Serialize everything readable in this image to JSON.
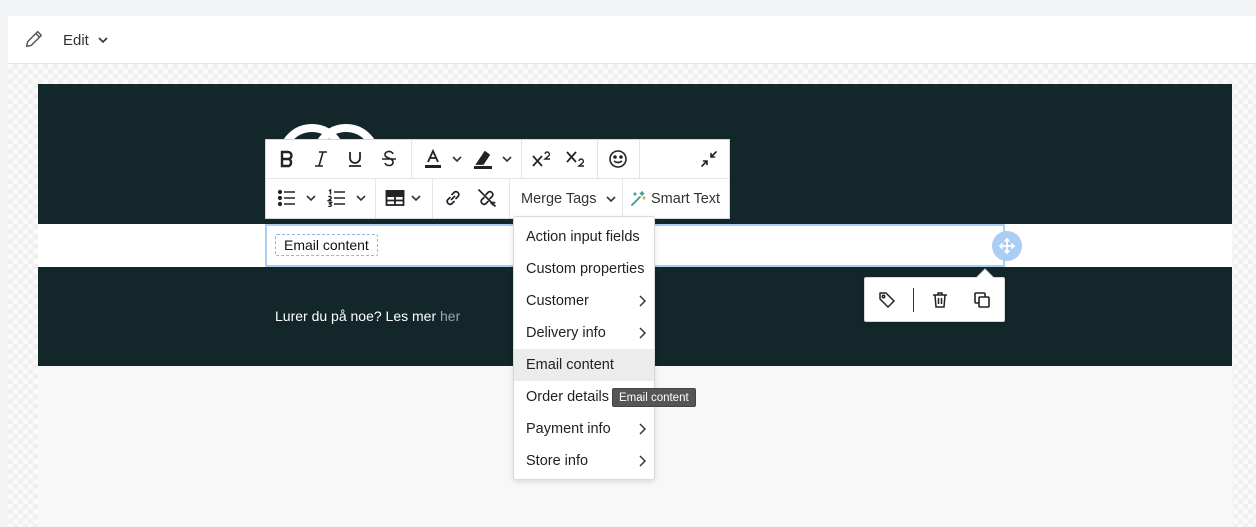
{
  "toolbar": {
    "mode_label": "Edit",
    "pencil_icon": "pencil-icon",
    "chevron_icon": "chevron-down-icon"
  },
  "email": {
    "header_color": "#13262a",
    "merge_chip_label": "Email content",
    "footer_text": "Lurer du på noe? Les mer ",
    "footer_link": "her"
  },
  "rich_text_toolbar": {
    "row1": [
      "bold-icon",
      "italic-icon",
      "underline-icon",
      "strikethrough-icon",
      "font-color-icon",
      "highlight-icon",
      "superscript-icon",
      "subscript-icon",
      "emoji-icon",
      "collapse-icon"
    ],
    "row2": [
      "bulleted-list-icon",
      "numbered-list-icon",
      "table-icon",
      "link-icon",
      "unlink-icon"
    ],
    "merge_tags_label": "Merge Tags",
    "smart_text_label": "Smart Text"
  },
  "merge_tags_menu": {
    "items": [
      {
        "label": "Action input fields",
        "has_submenu": false
      },
      {
        "label": "Custom properties",
        "has_submenu": false
      },
      {
        "label": "Customer",
        "has_submenu": true
      },
      {
        "label": "Delivery info",
        "has_submenu": true
      },
      {
        "label": "Email content",
        "has_submenu": false,
        "hovered": true
      },
      {
        "label": "Order details",
        "has_submenu": false
      },
      {
        "label": "Payment info",
        "has_submenu": true
      },
      {
        "label": "Store info",
        "has_submenu": true
      }
    ],
    "tooltip": "Email content"
  },
  "block_actions": [
    "tag-icon",
    "trash-icon",
    "duplicate-icon"
  ]
}
